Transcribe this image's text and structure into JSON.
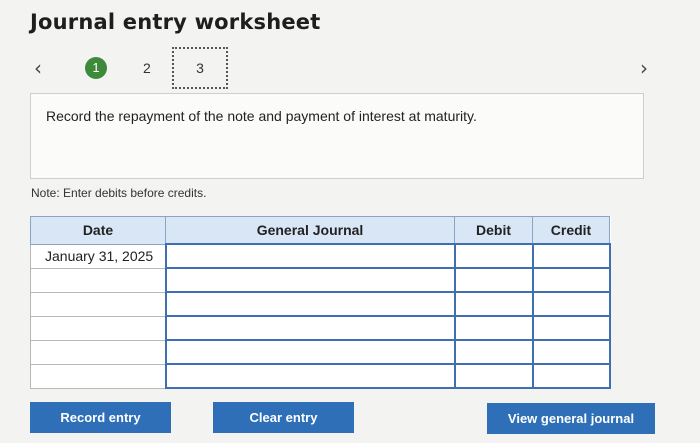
{
  "header": {
    "title": "Journal entry worksheet"
  },
  "navigation": {
    "prev_icon": "‹",
    "next_icon": "›",
    "steps": [
      "1",
      "2",
      "3"
    ],
    "active_step": "1"
  },
  "instruction": "Record the repayment of the note and payment of interest at maturity.",
  "note": "Note: Enter debits before credits.",
  "table": {
    "headers": {
      "date": "Date",
      "general_journal": "General Journal",
      "debit": "Debit",
      "credit": "Credit"
    },
    "rows": [
      {
        "date": "January 31, 2025"
      },
      {
        "date": ""
      },
      {
        "date": ""
      },
      {
        "date": ""
      },
      {
        "date": ""
      },
      {
        "date": ""
      }
    ]
  },
  "buttons": {
    "record": "Record entry",
    "clear": "Clear entry",
    "view": "View general journal"
  },
  "colors": {
    "accent": "#2e6fb8",
    "step_active": "#3d8a3a",
    "header_bg": "#d8e6f6"
  }
}
